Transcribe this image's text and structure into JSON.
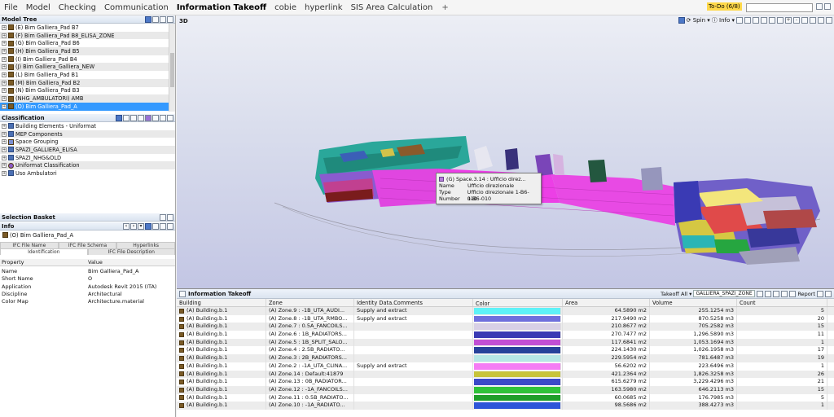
{
  "menu": {
    "items": [
      "File",
      "Model",
      "Checking",
      "Communication",
      "Information Takeoff",
      "cobie",
      "hyperlink",
      "SIS Area Calculation"
    ],
    "active_index": 4,
    "add_tab": "+"
  },
  "todo": {
    "label": "To-Do (6/8)"
  },
  "model_tree": {
    "title": "Model Tree",
    "items": [
      {
        "label": "(E) Bim Galliera_Pad B7",
        "selected": false
      },
      {
        "label": "(F) Bim Galliera_Pad B8_ELISA_ZONE",
        "selected": false
      },
      {
        "label": "(G) Bim Galliera_Pad B6",
        "selected": false
      },
      {
        "label": "(H) Bim Galliera_Pad B5",
        "selected": false
      },
      {
        "label": "(I) Bim Galliera_Pad B4",
        "selected": false
      },
      {
        "label": "(J) Bim Galliera_Galliera_NEW",
        "selected": false
      },
      {
        "label": "(L) Bim Galliera_Pad B1",
        "selected": false
      },
      {
        "label": "(M) Bim Galliera_Pad B2",
        "selected": false
      },
      {
        "label": "(N) Bim Galliera_Pad B3",
        "selected": false
      },
      {
        "label": "(NHG_AMBULATORI) AMB",
        "selected": false
      },
      {
        "label": "(O) Bim Galliera_Pad_A",
        "selected": true
      }
    ]
  },
  "classification": {
    "title": "Classification",
    "items": [
      {
        "label": "Building Elements - Uniformat",
        "icon": "cls"
      },
      {
        "label": "MEP Components",
        "icon": "cls"
      },
      {
        "label": "Space Grouping",
        "icon": "cls2"
      },
      {
        "label": "SPAZI_GALLIERA_ELISA",
        "icon": "cls"
      },
      {
        "label": "SPAZI_NHG&OLD",
        "icon": "cls"
      },
      {
        "label": "Uniformat Classification",
        "icon": "uni"
      },
      {
        "label": "Uso Ambulatori",
        "icon": "cls"
      }
    ]
  },
  "selection_basket": {
    "title": "Selection Basket"
  },
  "info": {
    "title": "Info",
    "object": "(O) Bim Galliera_Pad_A",
    "tabs_top": [
      "IFC File Name",
      "IFC File Schema",
      "Hyperlinks"
    ],
    "tabs_bottom": [
      "Identification",
      "IFC File Description"
    ],
    "col_property": "Property",
    "col_value": "Value",
    "rows": [
      {
        "k": "Name",
        "v": "Bim Galliera_Pad_A"
      },
      {
        "k": "Short Name",
        "v": "O"
      },
      {
        "k": "Application",
        "v": "Autodesk Revit 2015 (ITA)"
      },
      {
        "k": "Discipline",
        "v": "Architectural"
      },
      {
        "k": "Color Map",
        "v": "Architecture.material"
      }
    ]
  },
  "viewport": {
    "label": "3D",
    "spin_label": "Spin",
    "info_label": "Info",
    "tooltip": {
      "title": "(G) Space.3.14 : Ufficio direz...",
      "rows": [
        {
          "k": "Name",
          "v": "Ufficio direzionale"
        },
        {
          "k": "Type",
          "v": "Ufficio direzionale 1-B6-010"
        },
        {
          "k": "Number",
          "v": "1-B6-010"
        }
      ]
    }
  },
  "takeoff": {
    "title": "Information Takeoff",
    "takeoff_all": "Takeoff All",
    "zone_filter": "GALLIERA_SPAZI_ZONE",
    "report": "Report",
    "columns": [
      "Building",
      "Zone",
      "Identity Data.Comments",
      "Color",
      "Area",
      "Volume",
      "Count"
    ],
    "rows": [
      {
        "b": "(A) Building.b.1",
        "z": "(A) Zone.9 : -1B_UTA_AUDI...",
        "i": "Supply and extract",
        "color": "#5ef2f7",
        "a": "64.5890 m2",
        "v": "255.1254 m3",
        "n": "5"
      },
      {
        "b": "(A) Building.b.1",
        "z": "(A) Zone.8 : -1B_UTA_RMBO...",
        "i": "Supply and extract",
        "color": "#6f6fdc",
        "a": "217.9490 m2",
        "v": "870.5258 m3",
        "n": "20"
      },
      {
        "b": "(A) Building.b.1",
        "z": "(A) Zone.7 : 0.5A_FANCOILS...",
        "i": "",
        "color": "#d8d0e6",
        "a": "210.8677 m2",
        "v": "705.2582 m3",
        "n": "15"
      },
      {
        "b": "(A) Building.b.1",
        "z": "(A) Zone.6 : 1B_RADIATORS...",
        "i": "",
        "color": "#3a3ab4",
        "a": "270.7477 m2",
        "v": "1,296.5890 m3",
        "n": "11"
      },
      {
        "b": "(A) Building.b.1",
        "z": "(A) Zone.5 : 1B_SPLIT_SALO...",
        "i": "",
        "color": "#c24fd4",
        "a": "117.6841 m2",
        "v": "1,053.1694 m3",
        "n": "1"
      },
      {
        "b": "(A) Building.b.1",
        "z": "(A) Zone.4 : 2.5B_RADIATO...",
        "i": "",
        "color": "#27419a",
        "a": "224.1430 m2",
        "v": "1,026.1958 m3",
        "n": "17"
      },
      {
        "b": "(A) Building.b.1",
        "z": "(A) Zone.3 : 2B_RADIATORS...",
        "i": "",
        "color": "#b7e6e6",
        "a": "229.5954 m2",
        "v": "781.6487 m3",
        "n": "19"
      },
      {
        "b": "(A) Building.b.1",
        "z": "(A) Zone.2 : -1A_UTA_CLINA...",
        "i": "Supply and extract",
        "color": "#f57df4",
        "a": "56.6202 m2",
        "v": "223.6496 m3",
        "n": "1"
      },
      {
        "b": "(A) Building.b.1",
        "z": "(A) Zone.14 : Default:41879",
        "i": "",
        "color": "#c7c43a",
        "a": "421.2364 m2",
        "v": "1,826.3258 m3",
        "n": "26"
      },
      {
        "b": "(A) Building.b.1",
        "z": "(A) Zone.13 : 0B_RADIATOR...",
        "i": "",
        "color": "#3b49c8",
        "a": "615.6279 m2",
        "v": "3,229.4296 m3",
        "n": "21"
      },
      {
        "b": "(A) Building.b.1",
        "z": "(A) Zone.12 : -1A_FANCOILS...",
        "i": "",
        "color": "#2fc23a",
        "a": "163.5980 m2",
        "v": "646.2113 m3",
        "n": "15"
      },
      {
        "b": "(A) Building.b.1",
        "z": "(A) Zone.11 : 0.5B_RADIATO...",
        "i": "",
        "color": "#1e9e2a",
        "a": "60.0685 m2",
        "v": "176.7985 m3",
        "n": "5"
      },
      {
        "b": "(A) Building.b.1",
        "z": "(A) Zone.10 : -1A_RADIATO...",
        "i": "",
        "color": "#2e55d8",
        "a": "98.5686 m2",
        "v": "388.4273 m3",
        "n": "1"
      }
    ]
  }
}
